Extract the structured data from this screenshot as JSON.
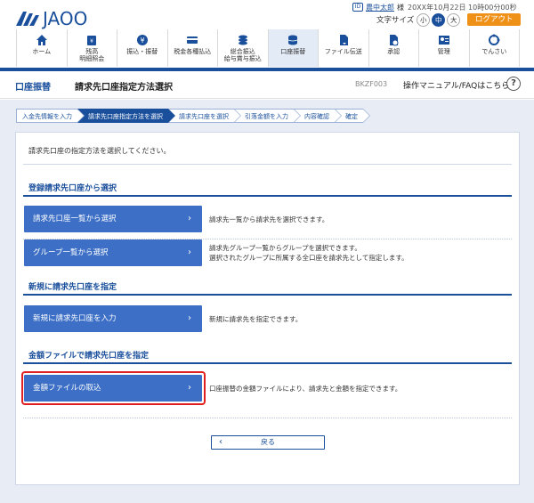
{
  "brand": {
    "logo_text": "JAOO",
    "accent": "#1a4f9c",
    "button": "#3c6fc5",
    "highlight": "#e02020",
    "logout_color": "#ef9017"
  },
  "user": {
    "icon": "id-card-icon",
    "name": "農中太郎",
    "suffix": "様",
    "last_login": "20XX年10月22日 10時00分00秒"
  },
  "font_size": {
    "label": "文字サイズ",
    "options": [
      "小",
      "中",
      "大"
    ],
    "selected": "中"
  },
  "logout_label": "ログアウト",
  "gnav": [
    {
      "icon": "home-icon",
      "label": "ホーム"
    },
    {
      "icon": "money-bag-icon",
      "label": "残高\n明細照会"
    },
    {
      "icon": "yen-icon",
      "label": "振込・振替"
    },
    {
      "icon": "card-icon",
      "label": "税金各種払込"
    },
    {
      "icon": "stack-icon",
      "label": "総合振込\n給与賞与振込"
    },
    {
      "icon": "coins-icon",
      "label": "口座振替",
      "active": true
    },
    {
      "icon": "file-icon",
      "label": "ファイル伝送"
    },
    {
      "icon": "approve-icon",
      "label": "承認"
    },
    {
      "icon": "admin-icon",
      "label": "管理"
    },
    {
      "icon": "e-tax-icon",
      "label": "でんさい"
    }
  ],
  "title": {
    "main": "口座振替",
    "sub": "請求先口座指定方法選択",
    "screen_id": "BKZF003",
    "help": "操作マニュアル/FAQはこちら"
  },
  "steps": [
    {
      "label": "入金先情報を入力"
    },
    {
      "label": "請求先口座指定方法を選択",
      "active": true
    },
    {
      "label": "請求先口座を選択"
    },
    {
      "label": "引落金額を入力"
    },
    {
      "label": "内容確認"
    },
    {
      "label": "確定"
    }
  ],
  "intro": "請求先口座の指定方法を選択してください。",
  "sections": {
    "registered": {
      "title": "登録請求先口座から選択",
      "btn1": "請求先口座一覧から選択",
      "desc1": "請求先一覧から請求先を選択できます。",
      "btn2": "グループ一覧から選択",
      "desc2_line1": "請求先グループ一覧からグループを選択できます。",
      "desc2_line2": "選択されたグループに所属する全口座を請求先として指定します。"
    },
    "new": {
      "title": "新規に請求先口座を指定",
      "btn": "新規に請求先口座を入力",
      "desc": "新規に請求先を指定できます。"
    },
    "file": {
      "title": "金額ファイルで請求先口座を指定",
      "btn": "金額ファイルの取込",
      "desc": "口座振替の金額ファイルにより、請求先と金額を指定できます。"
    }
  },
  "back_label": "戻る",
  "chevron_right": "›",
  "chevron_left": "‹"
}
